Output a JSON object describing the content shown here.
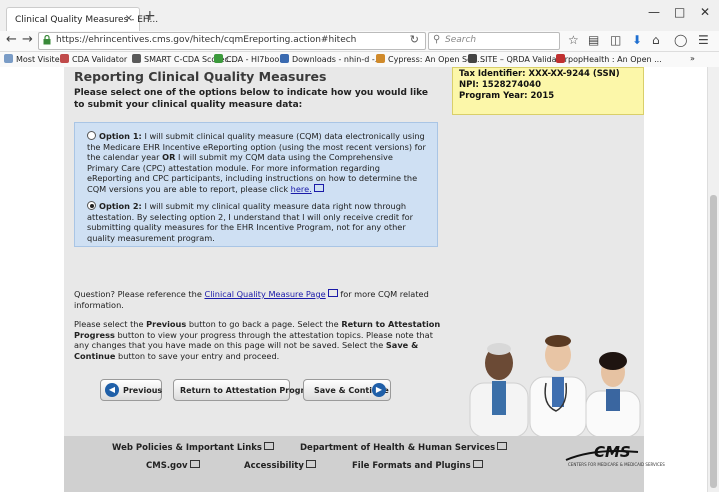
{
  "browser": {
    "tab_title": "Clinical Quality Measures - EH...",
    "tab_close": "×",
    "new_tab": "+",
    "url": "https://ehrincentives.cms.gov/hitech/cqmEreporting.action#hitech",
    "search_placeholder": "Search",
    "bookmarks": [
      "Most Visited",
      "CDA Validator",
      "SMART C-CDA Scorec...",
      "CDA - Hl7book",
      "Downloads - nhin-d -...",
      "Cypress: An Open Sou...",
      "SITE – QRDA Validator",
      "popHealth : An Open ..."
    ]
  },
  "page": {
    "title": "Reporting Clinical Quality Measures",
    "instruction": "Please select one of the options below to indicate how you would like to submit your clinical quality measure data:",
    "option1": {
      "label": "Option 1:",
      "text_a": "I will submit clinical quality measure (CQM) data electronically using the Medicare EHR Incentive eReporting option (using the most recent versions) for the calendar year",
      "or": "OR",
      "text_b": "I will submit my CQM data using the Comprehensive Primary Care (CPC) attestation module. For more information regarding eReporting and CPC participants, including instructions on how to determine the CQM versions you are able to report, please click",
      "link": "here."
    },
    "option2": {
      "label": "Option 2:",
      "text": "I will submit my clinical quality measure data right now through attestation. By selecting option 2, I understand that I will only receive credit for submitting quality measures for the EHR Incentive Program, not for any other quality measurement program."
    },
    "question": {
      "pre": "Question? Please reference the",
      "link": "Clinical Quality Measure Page",
      "post": "for more CQM related information."
    },
    "nav_instructions": {
      "t1": "Please select the",
      "b1": "Previous",
      "t2": "button to go back a page. Select the",
      "b2": "Return to Attestation Progress",
      "t3": "button to view your progress through the attestation topics. Please note that any changes that you have made on this page will not be saved. Select the",
      "b3": "Save & Continue",
      "t4": "button to save your entry and proceed."
    },
    "buttons": {
      "previous": "Previous",
      "return": "Return to Attestation Progress",
      "save": "Save & Continue"
    }
  },
  "provider": {
    "tax_id": "Tax Identifier: XXX-XX-9244 (SSN)",
    "npi": "NPI: 1528274040",
    "program_year": "Program Year: 2015"
  },
  "footer": {
    "web_policies": "Web Policies & Important Links",
    "dhhs": "Department of Health & Human Services",
    "cms_gov": "CMS.gov",
    "accessibility": "Accessibility",
    "file_formats": "File Formats and Plugins",
    "logo": "CMS",
    "logo_sub": "CENTERS FOR MEDICARE & MEDICAID SERVICES"
  }
}
